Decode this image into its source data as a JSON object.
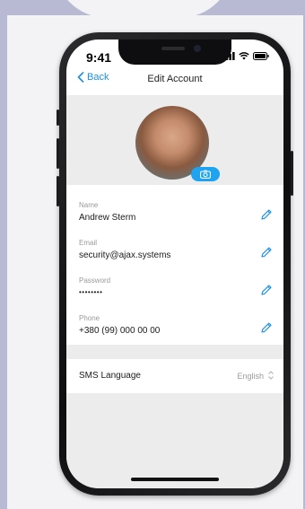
{
  "status": {
    "time": "9:41"
  },
  "nav": {
    "back_label": "Back",
    "title": "Edit Account"
  },
  "fields": [
    {
      "label": "Name",
      "value": "Andrew Sterm"
    },
    {
      "label": "Email",
      "value": "security@ajax.systems"
    },
    {
      "label": "Password",
      "value": "••••••••"
    },
    {
      "label": "Phone",
      "value": "+380 (99) 000 00 00"
    }
  ],
  "sms_language": {
    "label": "SMS Language",
    "value": "English"
  },
  "colors": {
    "accent": "#1a8fe3",
    "badge": "#1da3f2"
  }
}
